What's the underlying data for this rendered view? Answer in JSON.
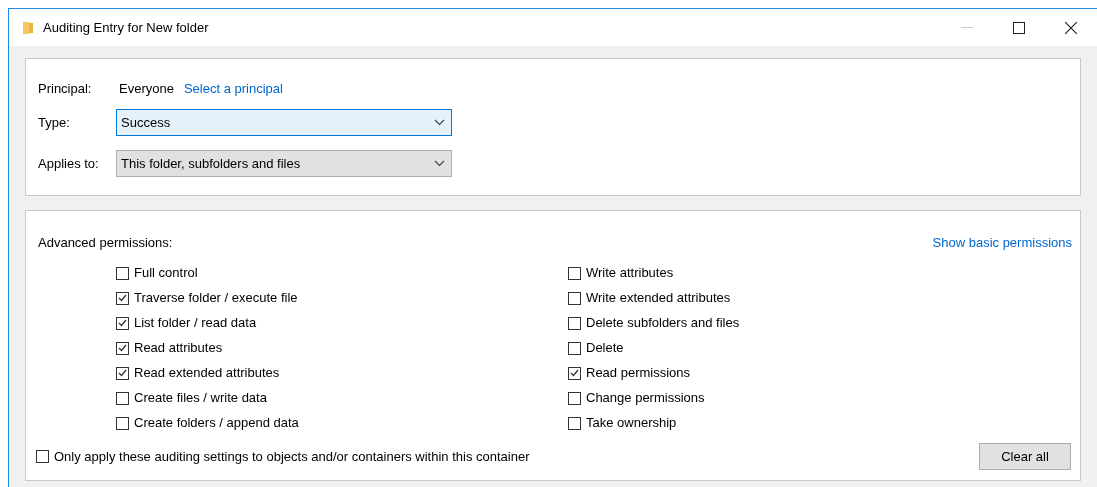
{
  "window": {
    "title": "Auditing Entry for New folder"
  },
  "principal": {
    "label": "Principal:",
    "value": "Everyone",
    "link": "Select a principal"
  },
  "type": {
    "label": "Type:",
    "value": "Success",
    "focused": true
  },
  "applies_to": {
    "label": "Applies to:",
    "value": "This folder, subfolders and files",
    "focused": false
  },
  "permissions": {
    "label": "Advanced permissions:",
    "link": "Show basic permissions",
    "columns": [
      [
        {
          "label": "Full control",
          "checked": false
        },
        {
          "label": "Traverse folder / execute file",
          "checked": true
        },
        {
          "label": "List folder / read data",
          "checked": true
        },
        {
          "label": "Read attributes",
          "checked": true
        },
        {
          "label": "Read extended attributes",
          "checked": true
        },
        {
          "label": "Create files / write data",
          "checked": false
        },
        {
          "label": "Create folders / append data",
          "checked": false
        }
      ],
      [
        {
          "label": "Write attributes",
          "checked": false
        },
        {
          "label": "Write extended attributes",
          "checked": false
        },
        {
          "label": "Delete subfolders and files",
          "checked": false
        },
        {
          "label": "Delete",
          "checked": false
        },
        {
          "label": "Read permissions",
          "checked": true
        },
        {
          "label": "Change permissions",
          "checked": false
        },
        {
          "label": "Take ownership",
          "checked": false
        }
      ]
    ]
  },
  "only_apply": {
    "label": "Only apply these auditing settings to objects and/or containers within this container",
    "checked": false
  },
  "clear_button": "Clear all"
}
